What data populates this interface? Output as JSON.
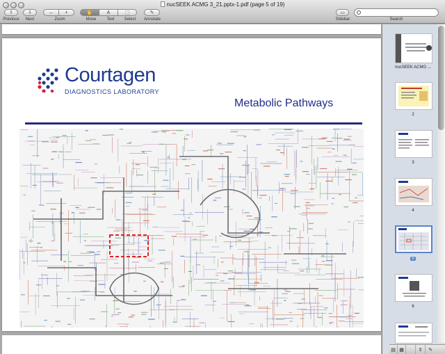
{
  "window": {
    "title": "nucSEEK ACMG 3_21.pptx-1.pdf (page 5 of 19)"
  },
  "toolbar": {
    "previous_label": "Previous",
    "next_label": "Next",
    "zoom_label": "Zoom",
    "move_label": "Move",
    "text_label": "Text",
    "select_label": "Select",
    "annotate_label": "Annotate",
    "sidebar_label": "Sidebar",
    "search_label": "Search",
    "search_placeholder": ""
  },
  "slide": {
    "logo_name": "Courtagen",
    "logo_subtitle": "DIAGNOSTICS LABORATORY",
    "title": "Metabolic Pathways"
  },
  "sidebar": {
    "thumbnails": [
      {
        "label": "nucSEEK ACMG ..."
      },
      {
        "label": "2"
      },
      {
        "label": "3"
      },
      {
        "label": "4"
      },
      {
        "label": "5",
        "selected": true
      },
      {
        "label": "6"
      }
    ]
  },
  "colors": {
    "brand_blue": "#1f3b8f",
    "logo_red": "#d3213a",
    "selection_blue": "#5b84c7"
  }
}
